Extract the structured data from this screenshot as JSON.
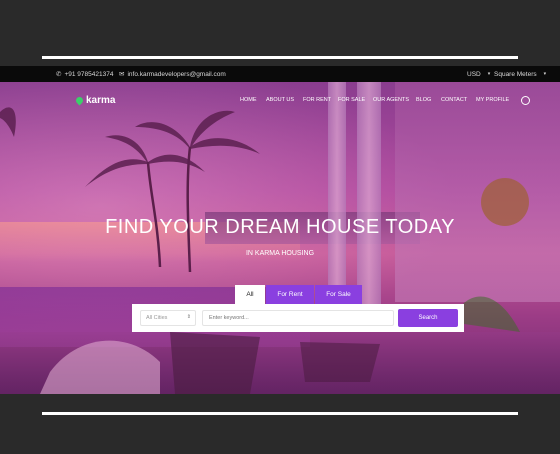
{
  "topbar": {
    "phone": "+91 9785421374",
    "email": "info.karmadevelopers@gmail.com",
    "currency": "USD",
    "units": "Square Meters"
  },
  "header": {
    "logo_text": "karma",
    "nav": [
      "HOME",
      "ABOUT US",
      "FOR RENT",
      "FOR SALE",
      "OUR AGENTS",
      "BLOG",
      "CONTACT",
      "MY PROFILE"
    ]
  },
  "hero": {
    "headline": "FIND YOUR DREAM HOUSE TODAY",
    "subheadline": "IN KARMA HOUSING"
  },
  "search": {
    "tabs": [
      "All",
      "For Rent",
      "For Sale"
    ],
    "city_select": "All Cities",
    "keyword_placeholder": "Enter keyword...",
    "button": "Search"
  },
  "icons": {
    "phone": "phone-icon",
    "email": "envelope-icon",
    "dropdown": "caret-down-icon",
    "user": "user-icon",
    "logo": "location-pin-icon"
  },
  "colors": {
    "accent": "#8a3fe0",
    "topbar": "#0a0a0a",
    "frame": "#2a2a2a",
    "logo_pin": "#3ccf6a"
  }
}
